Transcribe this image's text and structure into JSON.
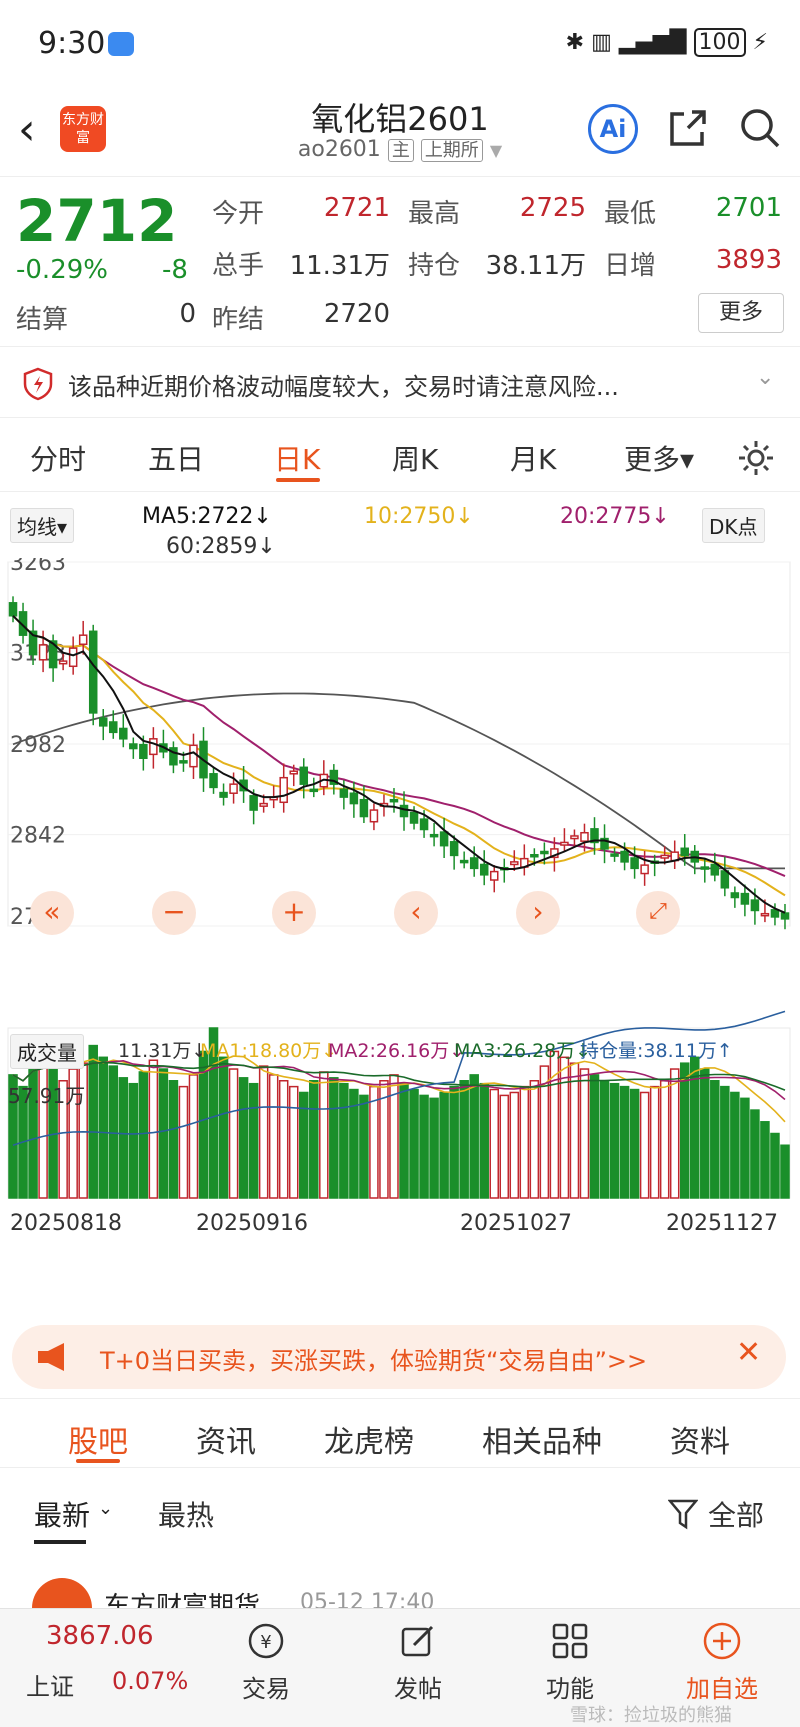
{
  "status": {
    "time": "9:30",
    "battery": "100"
  },
  "header": {
    "logo_text": "东方财富",
    "title": "氧化铝2601",
    "code": "ao2601",
    "tag_main": "主",
    "tag_exchange": "上期所",
    "ai_label": "Ai"
  },
  "quote": {
    "price": "2712",
    "change_pct": "-0.29%",
    "change": "-8",
    "settle_label": "结算",
    "settle_value": "0",
    "open_label": "今开",
    "open": "2721",
    "high_label": "最高",
    "high": "2725",
    "low_label": "最低",
    "low": "2701",
    "volume_label": "总手",
    "volume": "11.31万",
    "oi_label": "持仓",
    "oi": "38.11万",
    "daily_inc_label": "日增",
    "daily_inc": "3893",
    "prev_settle_label": "昨结",
    "prev_settle": "2720",
    "more_label": "更多"
  },
  "warning": {
    "text": "该品种近期价格波动幅度较大，交易时请注意风险..."
  },
  "kline_tabs": [
    "分时",
    "五日",
    "日K",
    "周K",
    "月K",
    "更多▾"
  ],
  "kline_active": "日K",
  "chart_controls": {
    "ma_select": "均线▾",
    "ma5": "MA5:2722↓",
    "ma10": "10:2750↓",
    "ma20": "20:2775↓",
    "ma60": "60:2859↓",
    "dk_label": "DK点",
    "vol_select": "成交量",
    "vol_value": "11.31万↓",
    "vol_ma1": "MA1:18.80万↓",
    "vol_ma2": "MA2:26.16万↓",
    "vol_ma3": "MA3:26.28万↓",
    "oi_value": "持仓量:38.11万↑",
    "vol_max": "57.91万"
  },
  "colors": {
    "up": "#c0262d",
    "down": "#1a8f2a",
    "ma5": "#111111",
    "ma10": "#e3b21c",
    "ma20": "#a0206c",
    "ma60": "#555555",
    "accent": "#e8541e"
  },
  "chart_data": {
    "type": "candlestick",
    "y_ticks": [
      "3263",
      "3123",
      "2982",
      "2842",
      "2701"
    ],
    "ylim": [
      2701,
      3263
    ],
    "x_labels": [
      "20250818",
      "20250916",
      "20251027",
      "20251127"
    ],
    "closes": [
      3180,
      3150,
      3120,
      3135,
      3100,
      3110,
      3130,
      3150,
      3030,
      3010,
      3000,
      2990,
      2975,
      2960,
      2990,
      2970,
      2950,
      2955,
      2980,
      2930,
      2915,
      2900,
      2920,
      2910,
      2880,
      2890,
      2900,
      2930,
      2940,
      2920,
      2910,
      2935,
      2920,
      2900,
      2890,
      2870,
      2880,
      2890,
      2895,
      2870,
      2860,
      2850,
      2840,
      2825,
      2810,
      2800,
      2790,
      2780,
      2785,
      2790,
      2800,
      2805,
      2810,
      2815,
      2820,
      2830,
      2840,
      2845,
      2830,
      2820,
      2810,
      2800,
      2790,
      2795,
      2800,
      2810,
      2815,
      2810,
      2800,
      2790,
      2780,
      2760,
      2745,
      2735,
      2725,
      2720,
      2715,
      2712
    ],
    "volumes": [
      42,
      38,
      50,
      47,
      55,
      40,
      44,
      46,
      52,
      48,
      45,
      41,
      39,
      43,
      47,
      44,
      40,
      38,
      42,
      50,
      58,
      48,
      44,
      41,
      39,
      45,
      42,
      40,
      38,
      36,
      40,
      43,
      41,
      39,
      37,
      35,
      38,
      40,
      42,
      39,
      37,
      35,
      34,
      36,
      38,
      40,
      42,
      39,
      37,
      35,
      36,
      38,
      40,
      45,
      50,
      48,
      46,
      44,
      42,
      40,
      39,
      38,
      37,
      36,
      38,
      40,
      44,
      46,
      48,
      44,
      40,
      38,
      36,
      34,
      30,
      26,
      22,
      18
    ]
  },
  "banner": {
    "text": "T+0当日买卖，买涨买跌，体验期货“交易自由”>>"
  },
  "bottom_tabs": [
    "股吧",
    "资讯",
    "龙虎榜",
    "相关品种",
    "资料"
  ],
  "feed_filters": {
    "latest": "最新",
    "hot": "最热",
    "all": "全部"
  },
  "post_preview": {
    "author": "东方财富期货",
    "time": "05-12 17:40"
  },
  "footer": {
    "index_value": "3867.06",
    "index_name": "上证",
    "index_change": "0.07%",
    "trade": "交易",
    "post": "发帖",
    "func": "功能",
    "add_watch": "加自选",
    "watermark": "雪球：捡垃圾的熊猫"
  }
}
